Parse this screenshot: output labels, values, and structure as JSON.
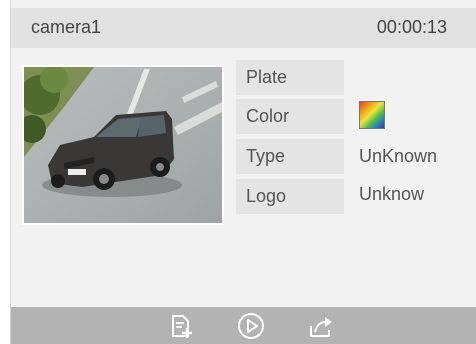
{
  "header": {
    "camera_name": "camera1",
    "timestamp": "00:00:13"
  },
  "attributes": [
    {
      "label": "Plate",
      "value": ""
    },
    {
      "label": "Color",
      "value": "",
      "swatch": "rainbow-gradient"
    },
    {
      "label": "Type",
      "value": "UnKnown"
    },
    {
      "label": "Logo",
      "value": "Unknow"
    }
  ],
  "snapshot": {
    "description_icon": "vehicle-snapshot"
  },
  "footer": {
    "buttons": [
      {
        "icon": "document-add-icon"
      },
      {
        "icon": "play-icon"
      },
      {
        "icon": "export-icon"
      }
    ]
  }
}
